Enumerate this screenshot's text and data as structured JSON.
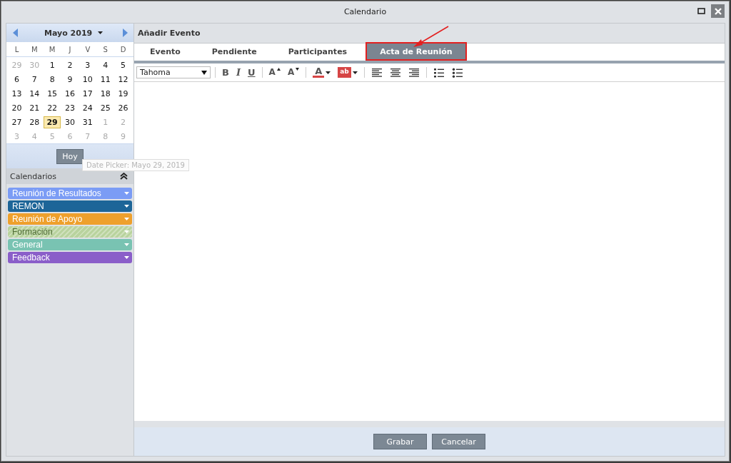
{
  "window": {
    "title": "Calendario"
  },
  "date_picker": {
    "month_label": "Mayo 2019",
    "weekdays": [
      "L",
      "M",
      "M",
      "J",
      "V",
      "S",
      "D"
    ],
    "weeks": [
      [
        {
          "day": "29",
          "muted": true,
          "selected": false
        },
        {
          "day": "30",
          "muted": true,
          "selected": false
        },
        {
          "day": "1",
          "muted": false,
          "selected": false
        },
        {
          "day": "2",
          "muted": false,
          "selected": false
        },
        {
          "day": "3",
          "muted": false,
          "selected": false
        },
        {
          "day": "4",
          "muted": false,
          "selected": false
        },
        {
          "day": "5",
          "muted": false,
          "selected": false
        }
      ],
      [
        {
          "day": "6",
          "muted": false,
          "selected": false
        },
        {
          "day": "7",
          "muted": false,
          "selected": false
        },
        {
          "day": "8",
          "muted": false,
          "selected": false
        },
        {
          "day": "9",
          "muted": false,
          "selected": false
        },
        {
          "day": "10",
          "muted": false,
          "selected": false
        },
        {
          "day": "11",
          "muted": false,
          "selected": false
        },
        {
          "day": "12",
          "muted": false,
          "selected": false
        }
      ],
      [
        {
          "day": "13",
          "muted": false,
          "selected": false
        },
        {
          "day": "14",
          "muted": false,
          "selected": false
        },
        {
          "day": "15",
          "muted": false,
          "selected": false
        },
        {
          "day": "16",
          "muted": false,
          "selected": false
        },
        {
          "day": "17",
          "muted": false,
          "selected": false
        },
        {
          "day": "18",
          "muted": false,
          "selected": false
        },
        {
          "day": "19",
          "muted": false,
          "selected": false
        }
      ],
      [
        {
          "day": "20",
          "muted": false,
          "selected": false
        },
        {
          "day": "21",
          "muted": false,
          "selected": false
        },
        {
          "day": "22",
          "muted": false,
          "selected": false
        },
        {
          "day": "23",
          "muted": false,
          "selected": false
        },
        {
          "day": "24",
          "muted": false,
          "selected": false
        },
        {
          "day": "25",
          "muted": false,
          "selected": false
        },
        {
          "day": "26",
          "muted": false,
          "selected": false
        }
      ],
      [
        {
          "day": "27",
          "muted": false,
          "selected": false
        },
        {
          "day": "28",
          "muted": false,
          "selected": false
        },
        {
          "day": "29",
          "muted": false,
          "selected": true
        },
        {
          "day": "30",
          "muted": false,
          "selected": false
        },
        {
          "day": "31",
          "muted": false,
          "selected": false
        },
        {
          "day": "1",
          "muted": true,
          "selected": false
        },
        {
          "day": "2",
          "muted": true,
          "selected": false
        }
      ],
      [
        {
          "day": "3",
          "muted": true,
          "selected": false
        },
        {
          "day": "4",
          "muted": true,
          "selected": false
        },
        {
          "day": "5",
          "muted": true,
          "selected": false
        },
        {
          "day": "6",
          "muted": true,
          "selected": false
        },
        {
          "day": "7",
          "muted": true,
          "selected": false
        },
        {
          "day": "8",
          "muted": true,
          "selected": false
        },
        {
          "day": "9",
          "muted": true,
          "selected": false
        }
      ]
    ],
    "today_button": "Hoy",
    "tooltip": "Date Picker: Mayo 29, 2019"
  },
  "calendars": {
    "title": "Calendarios",
    "expanded": true,
    "items": [
      {
        "label": "Reunión de Resultados",
        "color": "#7b9cf5",
        "disabled": false
      },
      {
        "label": "REMON",
        "color": "#1d6598",
        "disabled": false
      },
      {
        "label": "Reunión de Apoyo",
        "color": "#eea02c",
        "disabled": false
      },
      {
        "label": "Formación",
        "color": "#b9d39e",
        "disabled": true
      },
      {
        "label": "General",
        "color": "#79c3b2",
        "disabled": false
      },
      {
        "label": "Feedback",
        "color": "#8a5ec9",
        "disabled": false
      }
    ]
  },
  "panel": {
    "title": "Añadir Evento",
    "tabs": [
      {
        "label": "Evento",
        "selected": false,
        "annotated": false
      },
      {
        "label": "Pendiente",
        "selected": false,
        "annotated": false
      },
      {
        "label": "Participantes",
        "selected": false,
        "annotated": false
      },
      {
        "label": "Acta de Reunión",
        "selected": true,
        "annotated": true
      }
    ],
    "toolbar": [
      {
        "kind": "font",
        "value": "Tahoma"
      },
      {
        "kind": "sep"
      },
      {
        "kind": "bold",
        "label": "B"
      },
      {
        "kind": "italic",
        "label": "I"
      },
      {
        "kind": "underline",
        "label": "U"
      },
      {
        "kind": "sep"
      },
      {
        "kind": "grow",
        "label": "A"
      },
      {
        "kind": "shrink",
        "label": "A"
      },
      {
        "kind": "sep"
      },
      {
        "kind": "color",
        "label": "A"
      },
      {
        "kind": "highlight",
        "label": "ab"
      },
      {
        "kind": "sep"
      },
      {
        "kind": "left"
      },
      {
        "kind": "center"
      },
      {
        "kind": "right"
      },
      {
        "kind": "sep"
      },
      {
        "kind": "ol"
      },
      {
        "kind": "ul"
      }
    ]
  },
  "buttons": [
    "Grabar",
    "Cancelar"
  ]
}
